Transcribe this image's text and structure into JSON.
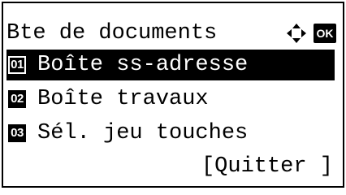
{
  "screen": {
    "title": "Bte de documents",
    "ok_label": "OK"
  },
  "menu": {
    "items": [
      {
        "number": "01",
        "label": "Boîte ss-adresse",
        "selected": true
      },
      {
        "number": "02",
        "label": "Boîte travaux",
        "selected": false
      },
      {
        "number": "03",
        "label": "Sél. jeu touches",
        "selected": false
      }
    ]
  },
  "footer": {
    "quit_label": "[Quitter ]"
  },
  "icons": {
    "nav": "four-way-arrow-icon",
    "ok": "ok-key-icon"
  }
}
